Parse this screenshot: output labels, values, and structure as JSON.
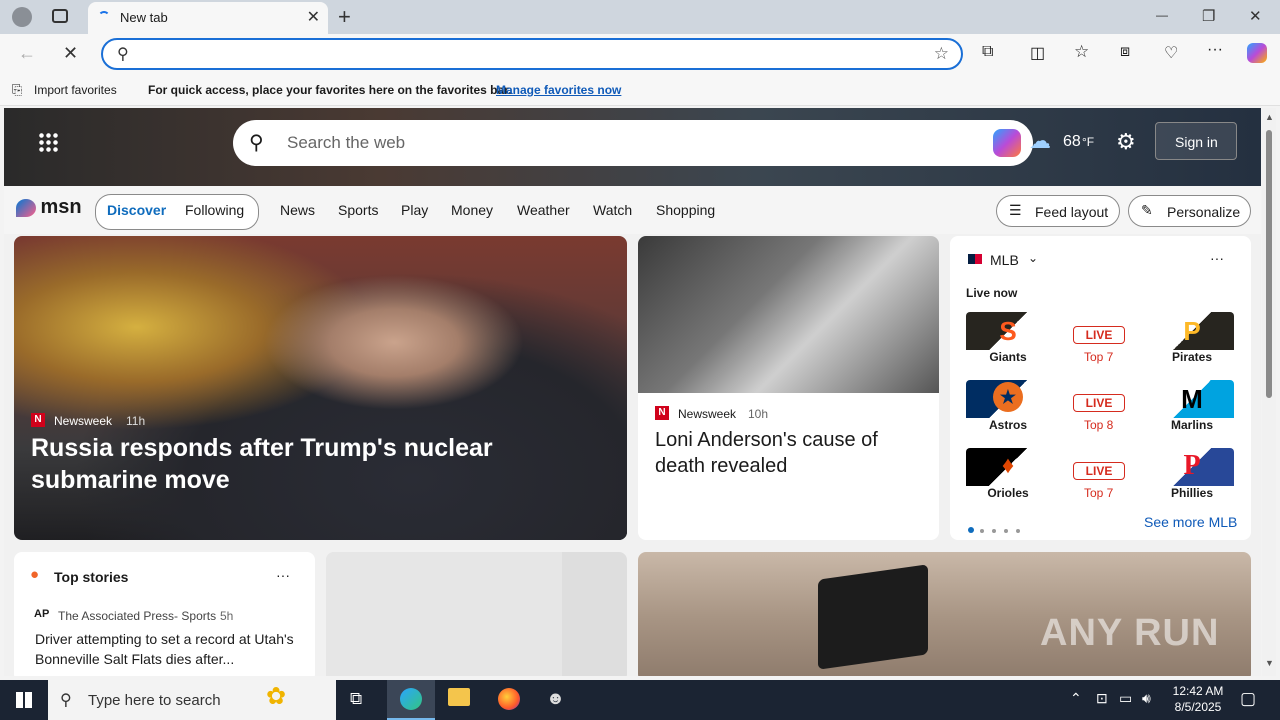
{
  "browser": {
    "tab_title": "New tab",
    "new_tab_symbol": "+",
    "tab_close_symbol": "✕",
    "omnibox_value": "",
    "window_controls": {
      "minimize": "—",
      "restore": "❐",
      "close": "✕"
    }
  },
  "favorites_bar": {
    "import_label": "Import favorites",
    "message": "For quick access, place your favorites here on the favorites bar.",
    "manage_link": "Manage favorites now"
  },
  "msn": {
    "search_placeholder": "Search the web",
    "weather_temp": "68",
    "weather_unit": "°F",
    "sign_in": "Sign in",
    "logo_text": "msn",
    "tabs": [
      "Discover",
      "Following"
    ],
    "nav_items": [
      "News",
      "Sports",
      "Play",
      "Money",
      "Weather",
      "Watch",
      "Shopping"
    ],
    "feed_layout": "Feed layout",
    "personalize": "Personalize"
  },
  "main_story": {
    "source": "Newsweek",
    "age": "11h",
    "headline": "Russia responds after Trump's nuclear submarine move"
  },
  "second_story": {
    "source": "Newsweek",
    "age": "10h",
    "headline": "Loni Anderson's cause of death revealed"
  },
  "mlb": {
    "title": "MLB",
    "live_now": "Live now",
    "see_more": "See more MLB",
    "games": [
      {
        "home": "Giants",
        "away": "Pirates",
        "status": "LIVE",
        "inning": "Top 7",
        "home_color": "#fd5a1e",
        "away_color": "#fdb827"
      },
      {
        "home": "Astros",
        "away": "Marlins",
        "status": "LIVE",
        "inning": "Top 8",
        "home_color": "#eb6e1f",
        "away_color": "#00a3e0"
      },
      {
        "home": "Orioles",
        "away": "Phillies",
        "status": "LIVE",
        "inning": "Top 7",
        "home_color": "#df4601",
        "away_color": "#e81828"
      }
    ]
  },
  "top_stories": {
    "title": "Top stories",
    "source": "The Associated Press- Sports",
    "age": "5h",
    "headline": "Driver attempting to set a record at Utah's Bonneville Salt Flats dies after..."
  },
  "taskbar": {
    "search_placeholder": "Type here to search",
    "time": "12:42 AM",
    "date": "8/5/2025"
  },
  "watermark": "ANY RUN"
}
